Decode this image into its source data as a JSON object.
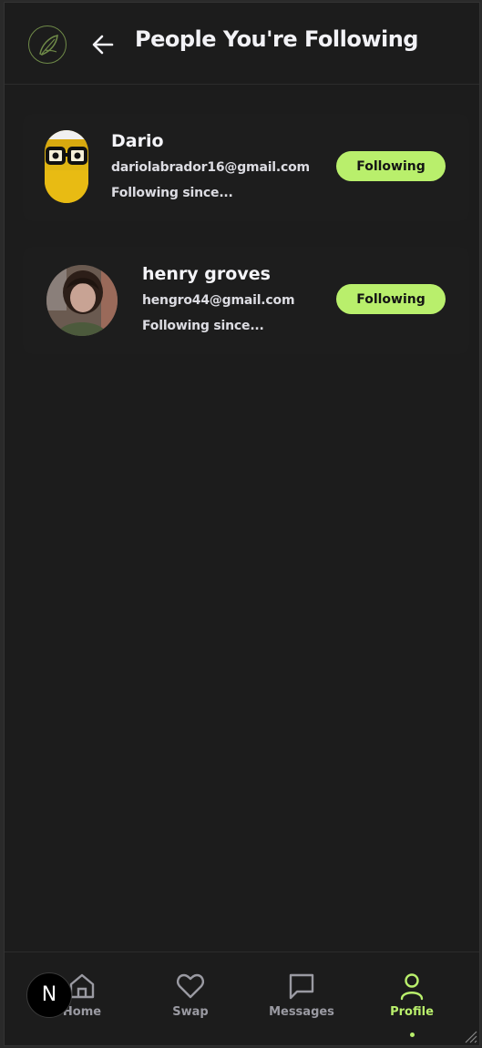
{
  "header": {
    "title": "People You're Following",
    "back_icon": "arrow-left-icon",
    "logo_icon": "leaf-logo-icon"
  },
  "following": [
    {
      "name": "Dario",
      "email": "dariolabrador16@gmail.com",
      "since": "Following since...",
      "button": "Following",
      "avatar": "yellow-glasses-avatar"
    },
    {
      "name": "henry groves",
      "email": "hengro44@gmail.com",
      "since": "Following since...",
      "button": "Following",
      "avatar": "photo-avatar"
    }
  ],
  "nav": {
    "items": [
      {
        "label": "Home",
        "icon": "home-icon"
      },
      {
        "label": "Swap",
        "icon": "heart-icon"
      },
      {
        "label": "Messages",
        "icon": "message-icon"
      },
      {
        "label": "Profile",
        "icon": "user-icon",
        "active": true
      }
    ]
  },
  "badge": {
    "letter": "N"
  },
  "colors": {
    "accent": "#b9ef6c",
    "background": "#1c1c1c",
    "text": "#f2f2f6",
    "muted": "#9a9aa2"
  }
}
